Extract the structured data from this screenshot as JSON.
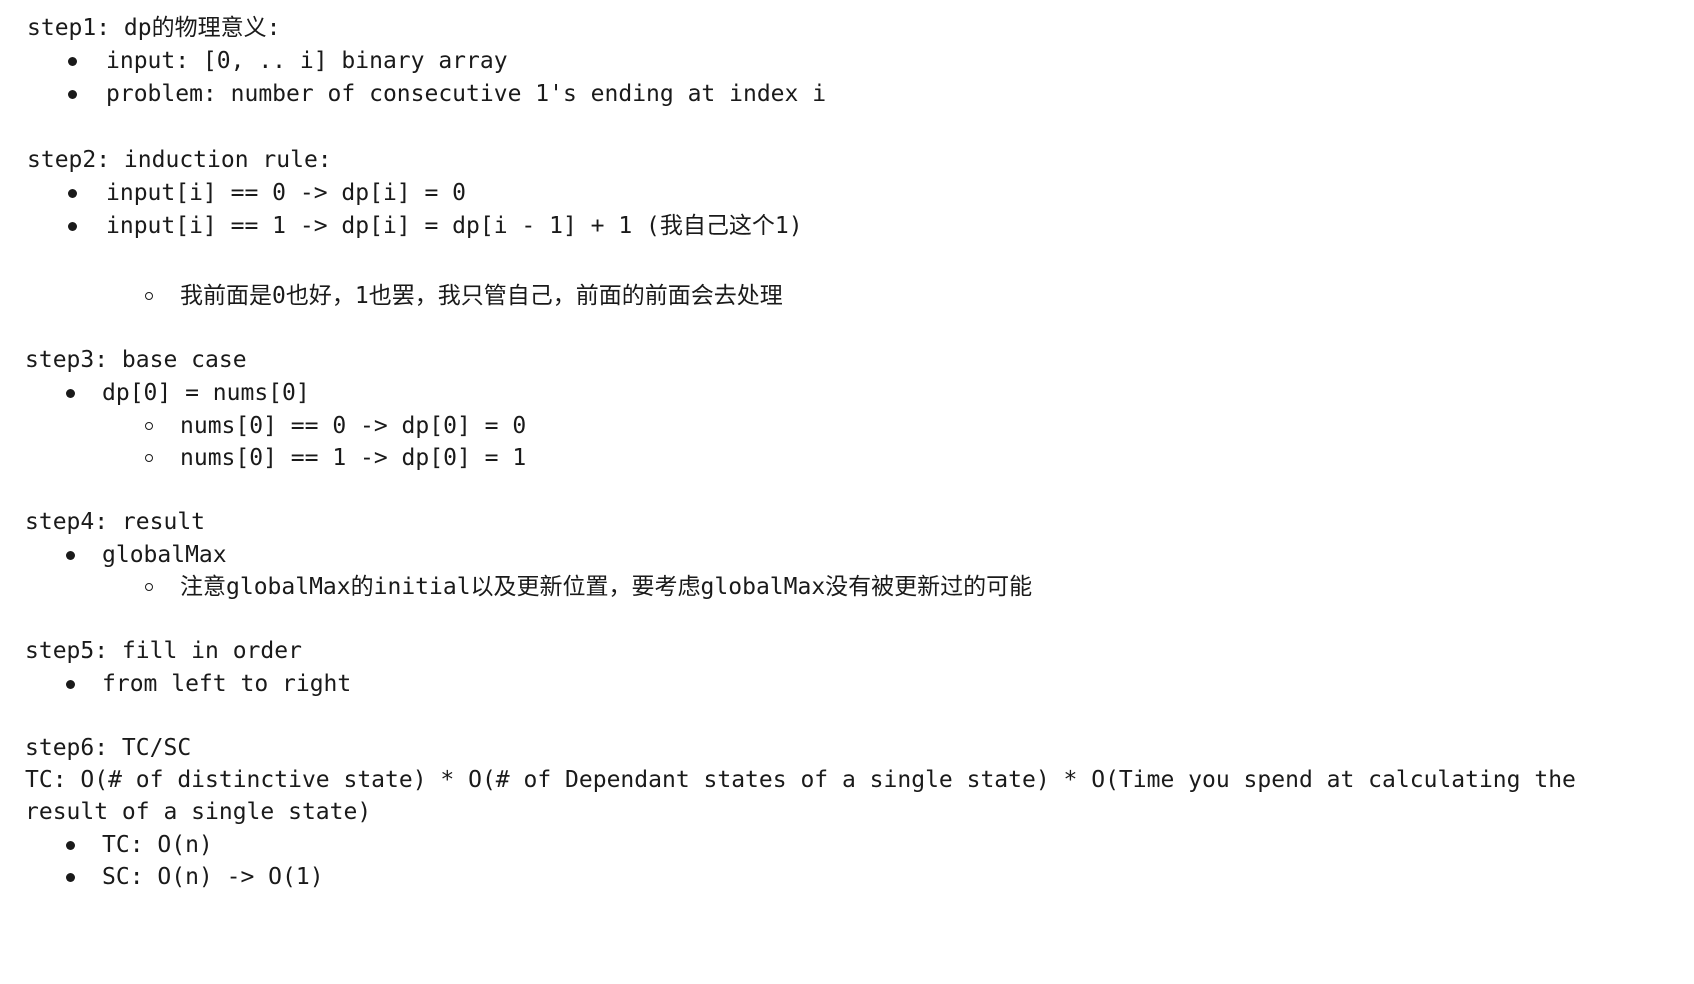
{
  "step1": {
    "heading": "step1: dp的物理意义:",
    "items": [
      "input: [0, .. i] binary array",
      "problem: number of consecutive 1's ending at index i"
    ]
  },
  "step2": {
    "heading": "step2: induction rule:",
    "items": [
      "input[i] == 0 -> dp[i] = 0",
      "input[i] == 1 -> dp[i] = dp[i - 1] + 1 (我自己这个1)"
    ],
    "sub_items": [
      "我前面是0也好，1也罢，我只管自己，前面的前面会去处理"
    ]
  },
  "step3": {
    "heading": "step3: base case",
    "items": [
      "dp[0] = nums[0]"
    ],
    "sub_items": [
      "nums[0] == 0 -> dp[0] = 0",
      "nums[0] == 1 -> dp[0] = 1"
    ]
  },
  "step4": {
    "heading": "step4: result",
    "items": [
      "globalMax"
    ],
    "sub_items": [
      "注意globalMax的initial以及更新位置，要考虑globalMax没有被更新过的可能"
    ]
  },
  "step5": {
    "heading": "step5: fill in order",
    "items": [
      "from left to right"
    ]
  },
  "step6": {
    "heading": "step6: TC/SC",
    "tc_line1": "TC: O(# of distinctive state) * O(# of Dependant states of a single state) * O(Time you spend at calculating the",
    "tc_line2": "result of a single state)",
    "items": [
      "TC: O(n)",
      "SC: O(n) -> O(1)"
    ]
  }
}
